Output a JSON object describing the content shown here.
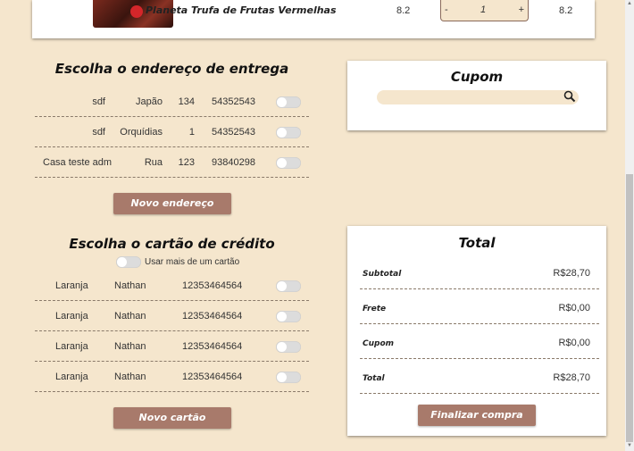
{
  "cart": {
    "product_name": "Planeta Trufa de Frutas Vermelhas",
    "price": "8.2",
    "quantity": "1",
    "minus": "-",
    "plus": "+",
    "subtotal": "8.2"
  },
  "address": {
    "title": "Escolha o endereço de entrega",
    "rows": [
      {
        "name": "sdf",
        "street": "Japão",
        "number": "134",
        "cep": "54352543"
      },
      {
        "name": "sdf",
        "street": "Orquídias",
        "number": "1",
        "cep": "54352543"
      },
      {
        "name": "Casa teste adm",
        "street": "Rua",
        "number": "123",
        "cep": "93840298"
      }
    ],
    "new_button": "Novo endereço"
  },
  "card": {
    "title": "Escolha o cartão de crédito",
    "multi_label": "Usar mais de um cartão",
    "rows": [
      {
        "name": "Laranja",
        "holder": "Nathan",
        "number": "12353464564"
      },
      {
        "name": "Laranja",
        "holder": "Nathan",
        "number": "12353464564"
      },
      {
        "name": "Laranja",
        "holder": "Nathan",
        "number": "12353464564"
      },
      {
        "name": "Laranja",
        "holder": "Nathan",
        "number": "12353464564"
      }
    ],
    "new_button": "Novo cartão"
  },
  "cupom": {
    "title": "Cupom",
    "placeholder": "",
    "icon": "search-icon"
  },
  "total": {
    "title": "Total",
    "rows": [
      {
        "label": "Subtotal",
        "value": "R$28,70"
      },
      {
        "label": "Frete",
        "value": "R$0,00"
      },
      {
        "label": "Cupom",
        "value": "R$0,00"
      },
      {
        "label": "Total",
        "value": "R$28,70"
      }
    ],
    "finish_button": "Finalizar compra"
  },
  "colors": {
    "background": "#f5e6cd",
    "button": "#a87a6b"
  }
}
